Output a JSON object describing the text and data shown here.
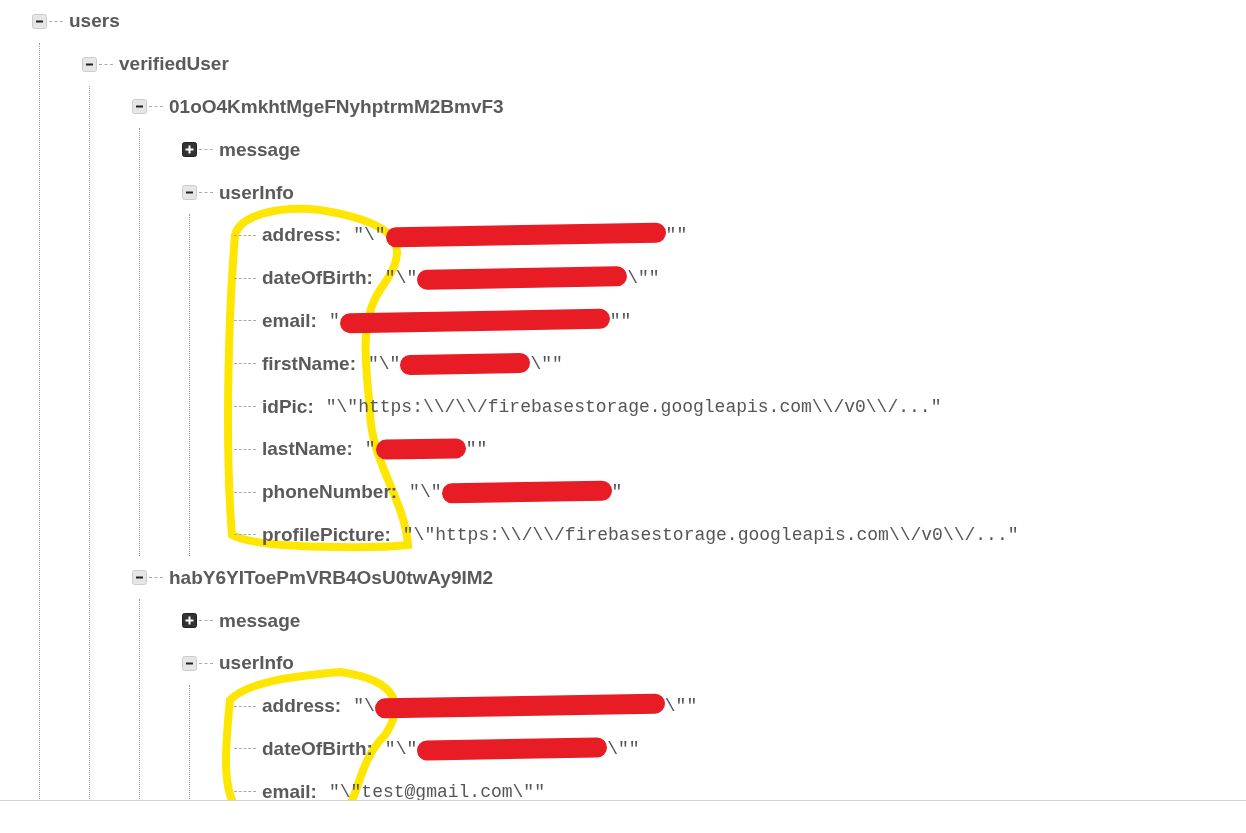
{
  "tree": [
    {
      "key": "users",
      "expanded": true,
      "children": [
        {
          "key": "verifiedUser",
          "expanded": true,
          "children": [
            {
              "key": "01oO4KmkhtMgeFNyhptrmM2BmvF3",
              "expanded": true,
              "children": [
                {
                  "key": "message",
                  "expanded": false
                },
                {
                  "key": "userInfo",
                  "expanded": true,
                  "children": [
                    {
                      "key": "address:",
                      "value_start": "\"\\\"",
                      "redacted": true,
                      "value_end": "\"\""
                    },
                    {
                      "key": "dateOfBirth:",
                      "value_start": "\"\\\"",
                      "redacted": true,
                      "value_end": "\\\"\""
                    },
                    {
                      "key": "email:",
                      "value_start": "\"",
                      "redacted": true,
                      "value_end": "\"\""
                    },
                    {
                      "key": "firstName:",
                      "value_start": "\"\\\"",
                      "redacted": true,
                      "value_end": "\\\"\""
                    },
                    {
                      "key": "idPic:",
                      "value_start": "\"\\\"https:\\\\/\\\\/firebasestorage.googleapis.com\\\\/v0\\\\/...\"",
                      "redacted": false
                    },
                    {
                      "key": "lastName:",
                      "value_start": "\"",
                      "redacted": true,
                      "value_end": "\"\""
                    },
                    {
                      "key": "phoneNumber:",
                      "value_start": "\"\\\"",
                      "redacted": true,
                      "value_end": "\""
                    },
                    {
                      "key": "profilePicture:",
                      "value_start": "\"\\\"https:\\\\/\\\\/firebasestorage.googleapis.com\\\\/v0\\\\/...\"",
                      "redacted": false
                    }
                  ]
                }
              ]
            },
            {
              "key": "habY6YIToePmVRB4OsU0twAy9IM2",
              "expanded": true,
              "children": [
                {
                  "key": "message",
                  "expanded": false
                },
                {
                  "key": "userInfo",
                  "expanded": true,
                  "children": [
                    {
                      "key": "address:",
                      "value_start": "\"\\",
                      "redacted": true,
                      "value_end": "\\\"\""
                    },
                    {
                      "key": "dateOfBirth:",
                      "value_start": "\"\\\"",
                      "redacted": true,
                      "value_end": "\\\"\""
                    },
                    {
                      "key": "email:",
                      "value_start": "\"\\\"test@gmail.com\\\"\"",
                      "redacted": false
                    }
                  ]
                }
              ]
            }
          ]
        }
      ]
    }
  ]
}
